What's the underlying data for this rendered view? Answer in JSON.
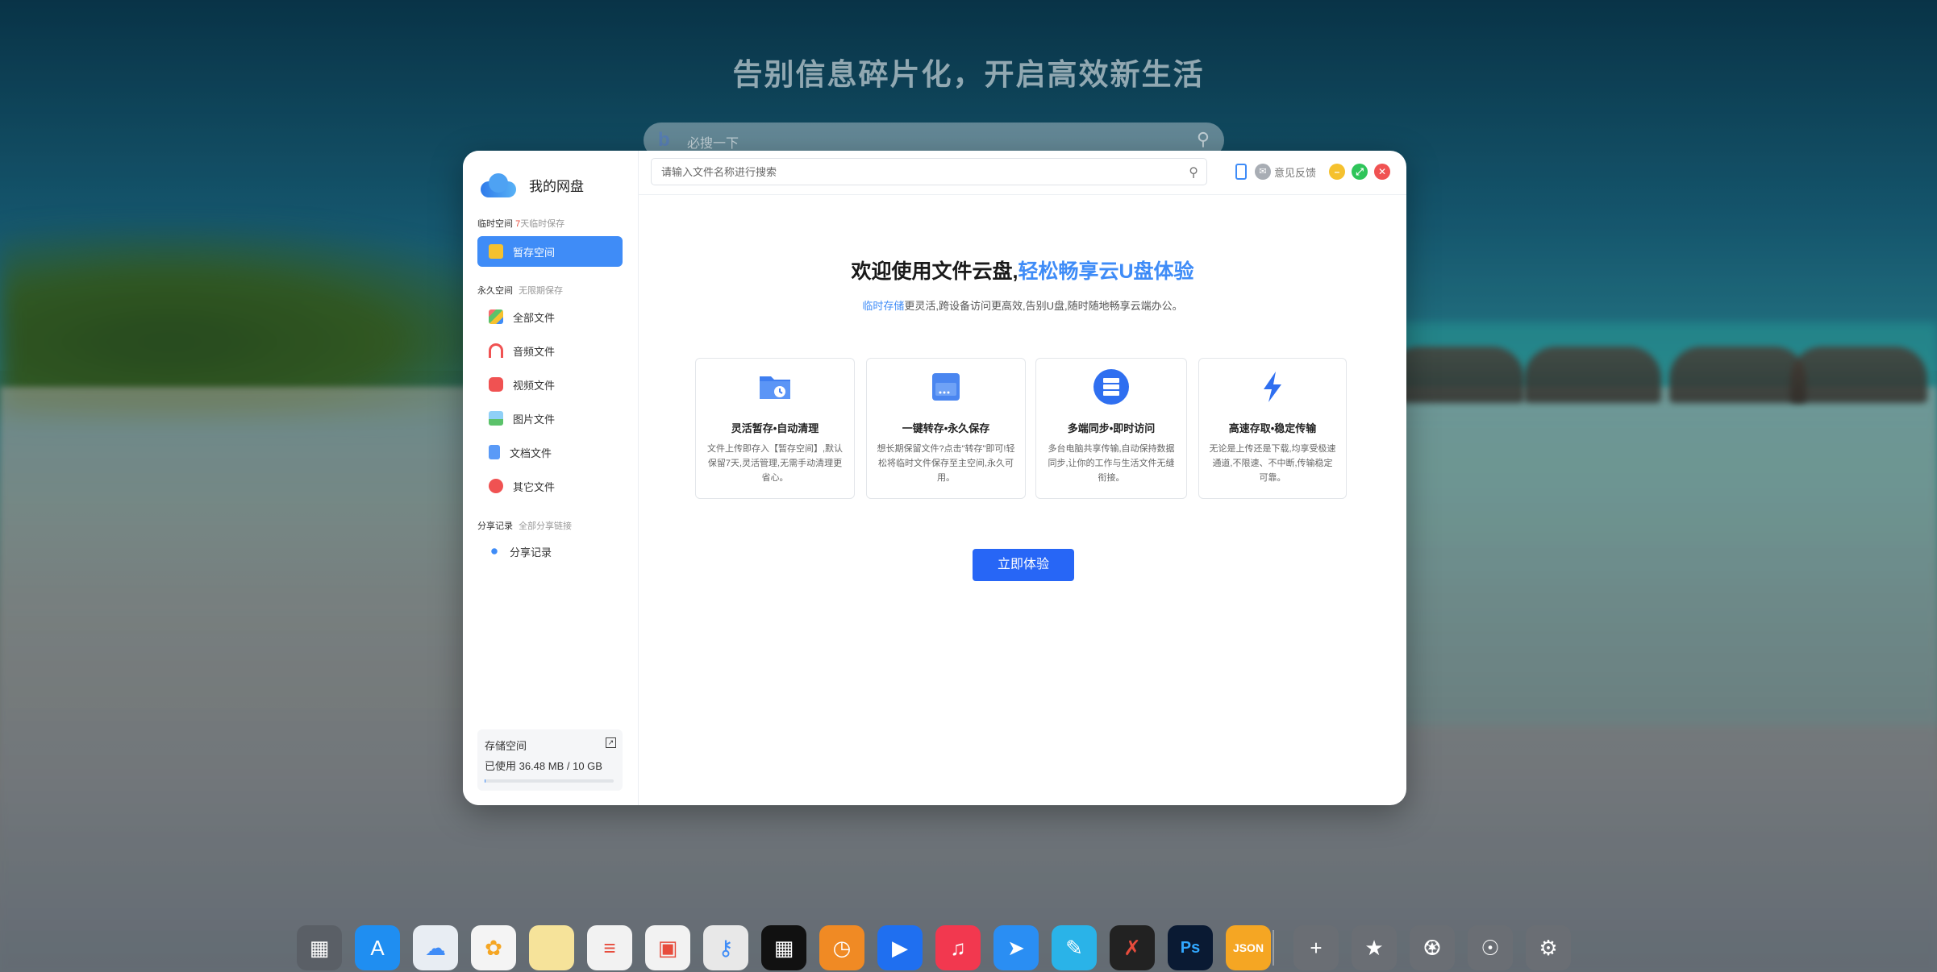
{
  "desktop": {
    "tagline": "告别信息碎片化，开启高效新生活",
    "search_placeholder": "必搜一下"
  },
  "window": {
    "brand": "我的网盘",
    "sections": {
      "temp": {
        "label": "临时空间",
        "sub_prefix": "7",
        "sub": "天临时保存"
      },
      "perm": {
        "label": "永久空间",
        "sub": "无限期保存"
      },
      "share": {
        "label": "分享记录",
        "sub": "全部分享链接"
      }
    },
    "nav": {
      "staging": "暂存空间",
      "all": "全部文件",
      "audio": "音频文件",
      "video": "视频文件",
      "image": "图片文件",
      "doc": "文档文件",
      "other": "其它文件",
      "share": "分享记录"
    },
    "storage": {
      "title": "存储空间",
      "used": "已使用 36.48 MB / 10 GB",
      "fraction": 0.0036
    },
    "search_placeholder": "请输入文件名称进行搜索",
    "feedback": "意见反馈",
    "welcome_main": "欢迎使用文件云盘,",
    "welcome_hl": "轻松畅享云U盘体验",
    "sub_hl": "临时存储",
    "sub_rest": "更灵活,跨设备访问更高效,告别U盘,随时随地畅享云端办公。",
    "cards": [
      {
        "title": "灵活暂存•自动清理",
        "desc": "文件上传即存入【暂存空间】,默认保留7天,灵活管理,无需手动清理更省心。",
        "icon": "folder-clock-icon"
      },
      {
        "title": "一键转存•永久保存",
        "desc": "想长期保留文件?点击\"转存\"即可!轻松将临时文件保存至主空间,永久可用。",
        "icon": "archive-box-icon"
      },
      {
        "title": "多端同步•即时访问",
        "desc": "多台电脑共享传输,自动保持数据同步,让你的工作与生活文件无缝衔接。",
        "icon": "server-icon"
      },
      {
        "title": "高速存取•稳定传输",
        "desc": "无论是上传还是下载,均享受极速通道,不限速、不中断,传输稳定可靠。",
        "icon": "lightning-icon"
      }
    ],
    "cta": "立即体验"
  },
  "dock": {
    "json_label": "JSON",
    "ps_label": "Ps"
  },
  "colors": {
    "accent": "#3f8cf7",
    "button": "#2766f6"
  }
}
